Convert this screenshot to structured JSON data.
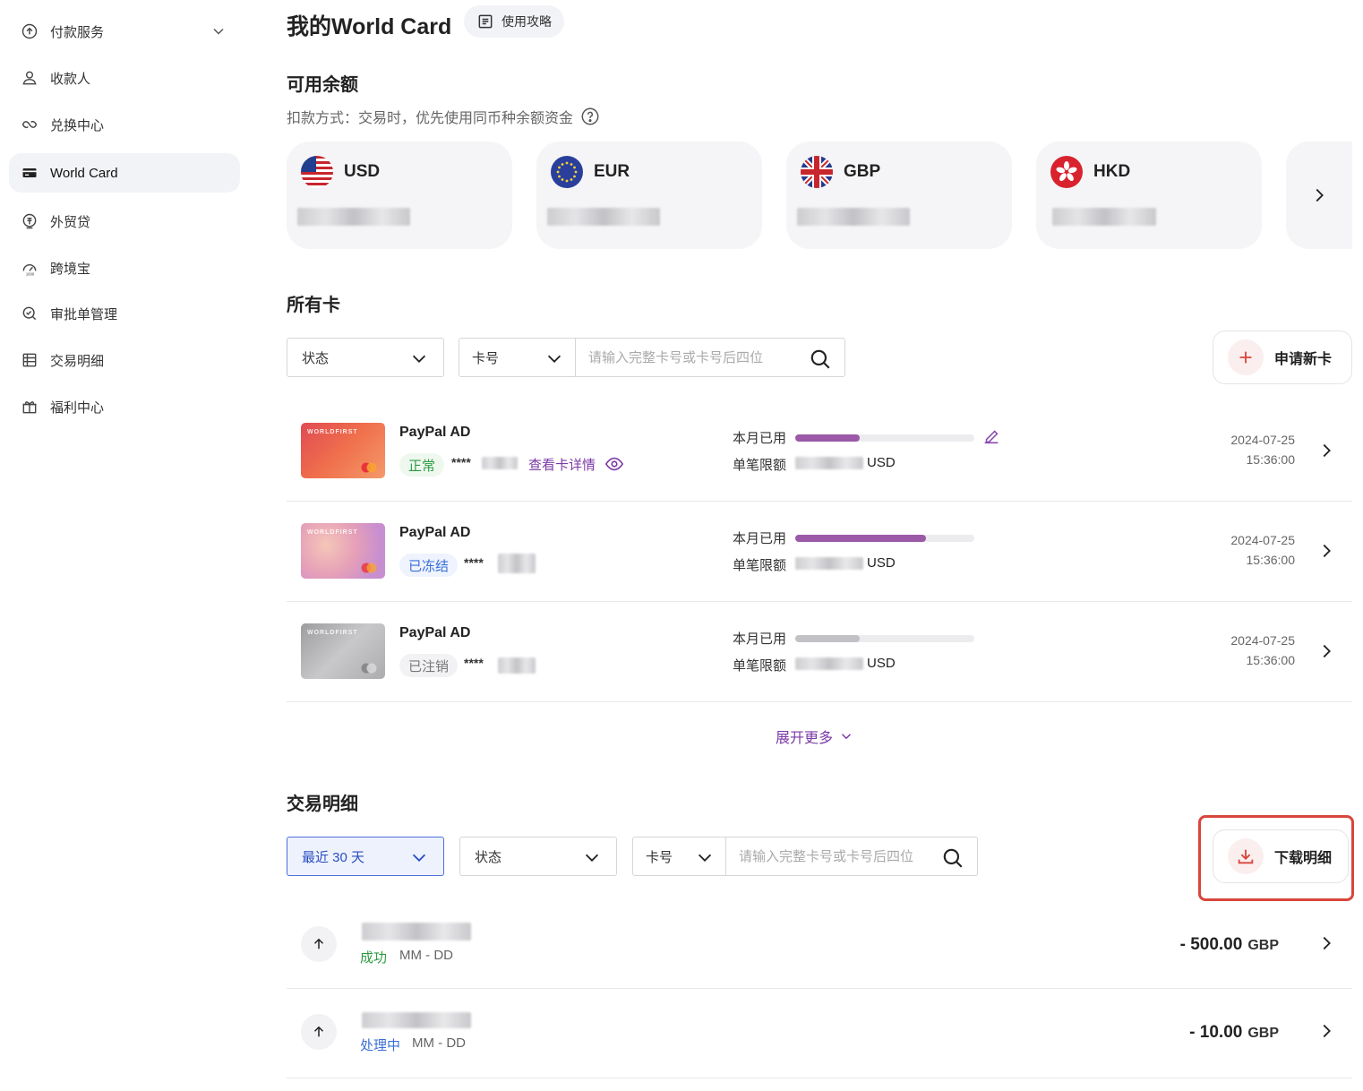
{
  "sidebar": {
    "items": [
      {
        "label": "付款服务",
        "icon": "payment-upload-icon"
      },
      {
        "label": "收款人",
        "icon": "user-icon"
      },
      {
        "label": "兑换中心",
        "icon": "exchange-icon"
      },
      {
        "label": "World Card",
        "icon": "card-icon",
        "active": true
      },
      {
        "label": "外贸贷",
        "icon": "loan-icon"
      },
      {
        "label": "跨境宝",
        "icon": "cross-border-icon"
      },
      {
        "label": "审批单管理",
        "icon": "approval-search-icon"
      },
      {
        "label": "交易明细",
        "icon": "list-icon"
      },
      {
        "label": "福利中心",
        "icon": "gift-icon"
      }
    ]
  },
  "header": {
    "title": "我的World Card",
    "guide_label": "使用攻略"
  },
  "balance": {
    "title": "可用余额",
    "subtitle": "扣款方式：交易时，优先使用同币种余额资金",
    "currencies": [
      {
        "code": "USD",
        "icon": "us-flag-icon"
      },
      {
        "code": "EUR",
        "icon": "eu-flag-icon"
      },
      {
        "code": "GBP",
        "icon": "uk-flag-icon"
      },
      {
        "code": "HKD",
        "icon": "hk-flag-icon"
      }
    ]
  },
  "cards": {
    "title": "所有卡",
    "filters": {
      "status_label": "状态",
      "cardno_label": "卡号",
      "search_placeholder": "请输入完整卡号或卡号后四位"
    },
    "apply_label": "申请新卡",
    "used_label": "本月已用",
    "limit_label": "单笔限额",
    "rows": [
      {
        "name": "PayPal AD",
        "status": "正常",
        "masked": "****",
        "detail_link": "查看卡详情",
        "limit_currency": "USD",
        "date": "2024-07-25",
        "time": "15:36:00",
        "brand": "WORLDFIRST",
        "usage": 0.36,
        "bar_color": "#9b59a7"
      },
      {
        "name": "PayPal AD",
        "status": "已冻结",
        "masked": "****",
        "limit_currency": "USD",
        "date": "2024-07-25",
        "time": "15:36:00",
        "brand": "WORLDFIRST",
        "usage": 0.73,
        "bar_color": "#9b59a7"
      },
      {
        "name": "PayPal AD",
        "status": "已注销",
        "masked": "****",
        "limit_currency": "USD",
        "date": "2024-07-25",
        "time": "15:36:00",
        "brand": "WORLDFIRST",
        "usage": 0.36,
        "bar_color": "#c2c2c6"
      }
    ],
    "expand_label": "展开更多"
  },
  "transactions": {
    "title": "交易明细",
    "filters": {
      "period_label": "最近 30 天",
      "status_label": "状态",
      "cardno_label": "卡号",
      "search_placeholder": "请输入完整卡号或卡号后四位"
    },
    "download_label": "下载明细",
    "rows": [
      {
        "status": "成功",
        "status_color": "#2e9a44",
        "date": "MM - DD",
        "amount": "- 500.00",
        "currency": "GBP"
      },
      {
        "status": "处理中",
        "status_color": "#3a6fd8",
        "date": "MM - DD",
        "amount": "- 10.00",
        "currency": "GBP"
      }
    ]
  }
}
